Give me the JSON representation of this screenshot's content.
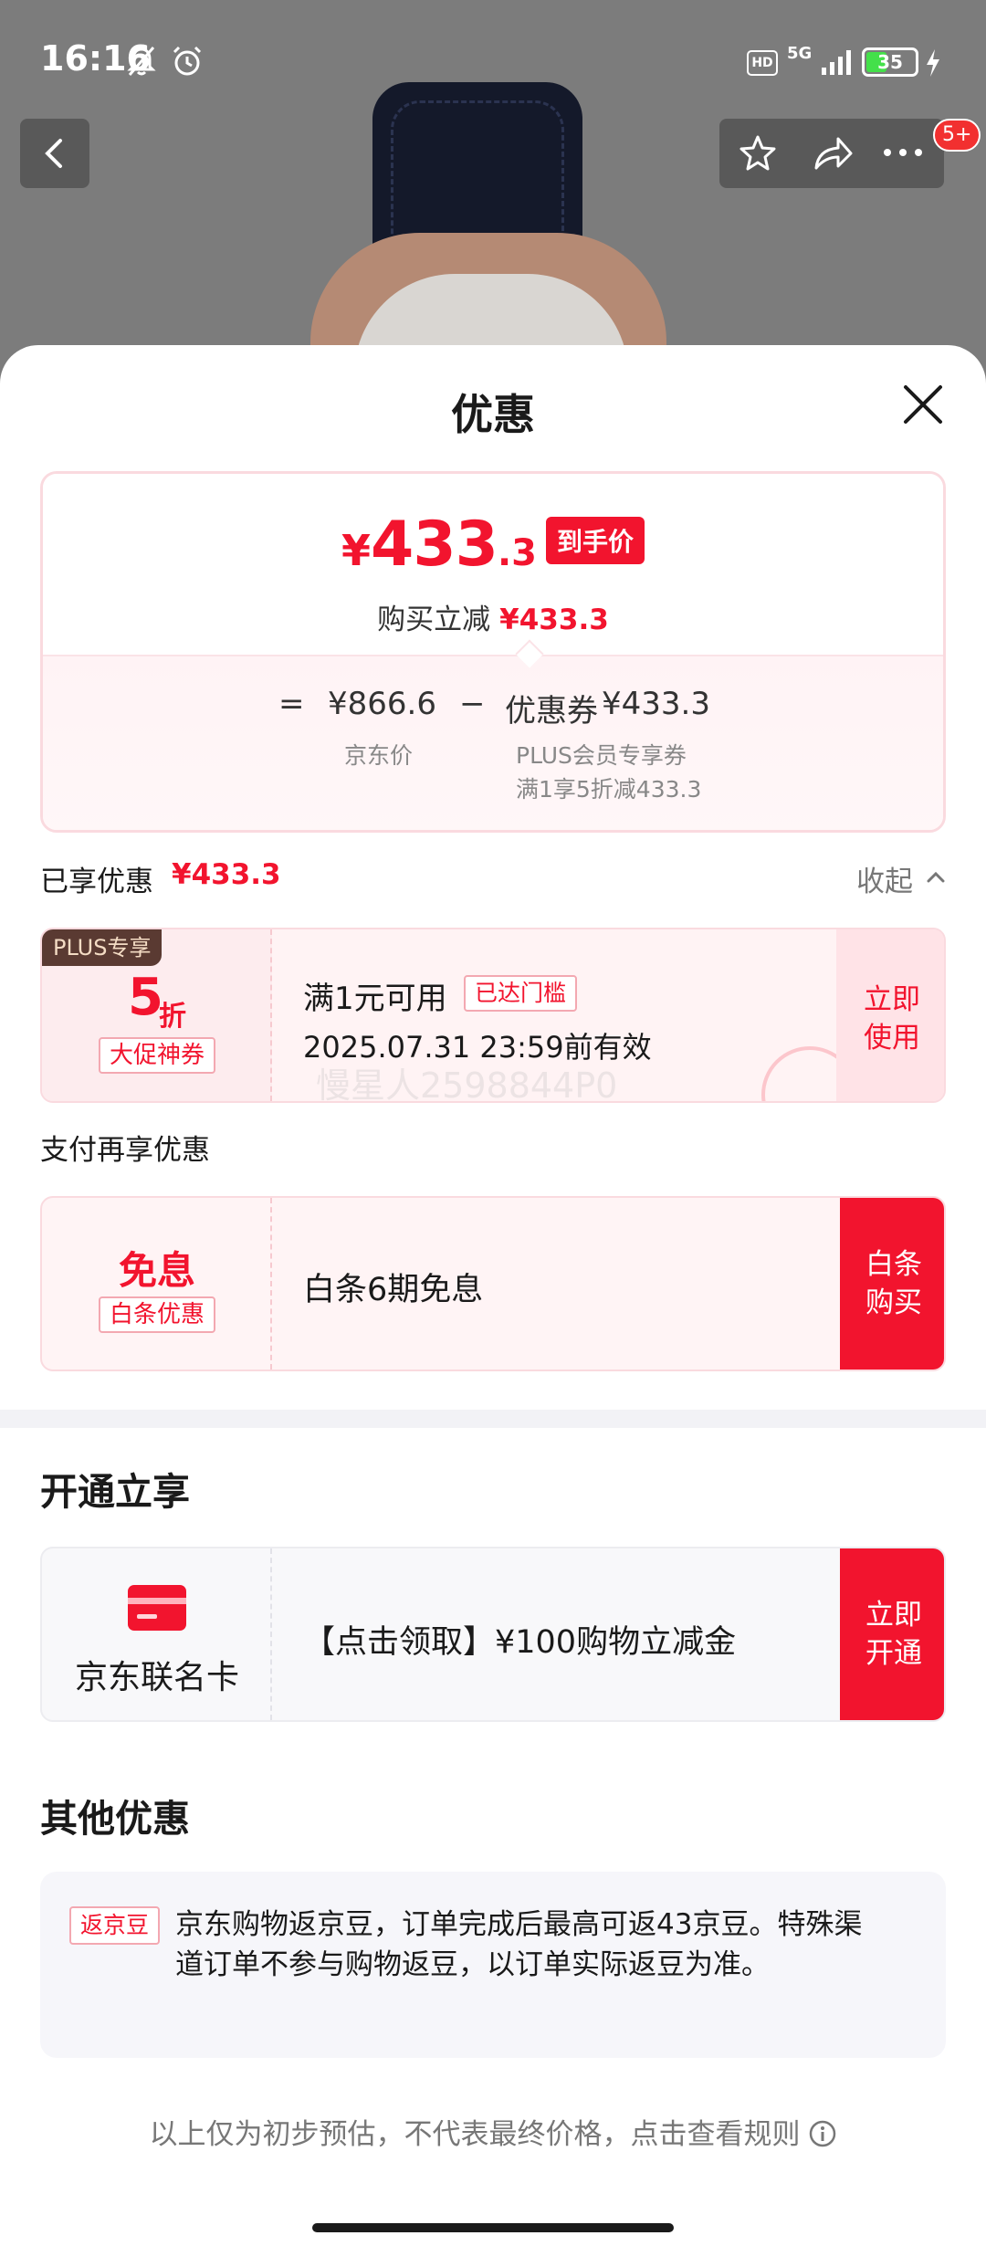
{
  "status_bar": {
    "time": "16:16",
    "network": "5G",
    "hd": "HD",
    "battery": "35"
  },
  "top_nav": {
    "badge": "5+"
  },
  "sheet": {
    "title": "优惠",
    "price": {
      "yen": "¥",
      "integer": "433",
      "decimal": ".3",
      "final_tag": "到手价",
      "sub_label": "购买立减",
      "sub_value": "¥433.3",
      "formula": {
        "eq": "=",
        "jd_price": "¥866.6",
        "minus": "−",
        "coupon_label": "优惠券",
        "coupon_value": "¥433.3",
        "jd_price_note": "京东价",
        "coupon_note_1": "PLUS会员专享券",
        "coupon_note_2": "满1享5折减433.3"
      }
    },
    "enjoyed": {
      "label": "已享优惠",
      "value": "¥433.3",
      "collapse": "收起"
    },
    "coupon": {
      "plus_tag": "PLUS专享",
      "discount_num": "5",
      "discount_unit": "折",
      "type_tag": "大促神券",
      "condition": "满1元可用",
      "reached_tag": "已达门槛",
      "valid": "2025.07.31 23:59前有效",
      "watermark": "慢星人2598844P0",
      "action_line1": "立即",
      "action_line2": "使用"
    },
    "pay_section": {
      "title": "支付再享优惠",
      "card_title": "免息",
      "card_tag": "白条优惠",
      "desc": "白条6期免息",
      "action_line1": "白条",
      "action_line2": "购买"
    },
    "open_section": {
      "title": "开通立享",
      "card_label": "京东联名卡",
      "desc": "【点击领取】¥100购物立减金",
      "action_line1": "立即",
      "action_line2": "开通"
    },
    "other_section": {
      "title": "其他优惠",
      "tag": "返京豆",
      "text": "京东购物返京豆，订单完成后最高可返43京豆。特殊渠道订单不参与购物返豆，以订单实际返豆为准。"
    },
    "footer": "以上仅为初步预估，不代表最终价格，点击查看规则"
  },
  "colors": {
    "accent": "#f2142e",
    "plus_tag_bg": "#5a3a32"
  }
}
